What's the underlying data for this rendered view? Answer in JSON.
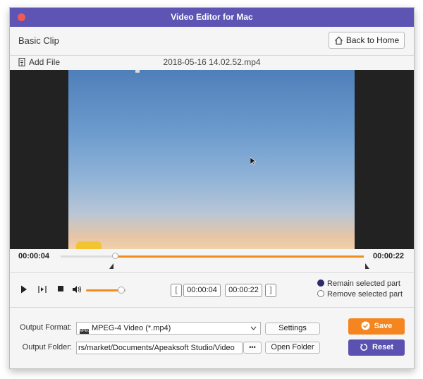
{
  "window": {
    "title": "Video Editor for Mac"
  },
  "header": {
    "clip_title": "Basic Clip",
    "back_home_label": "Back to Home"
  },
  "file_bar": {
    "add_file_label": "Add File",
    "file_name": "2018-05-16 14.02.52.mp4"
  },
  "timeline": {
    "current_time": "00:00:04",
    "end_time": "00:00:22",
    "played_fraction": 0.18
  },
  "playback": {
    "volume_fraction": 0.9,
    "start_time": "00:00:04",
    "end_time": "00:00:22",
    "remain_label": "Remain selected part",
    "remove_label": "Remove selected part",
    "selected_option": "remain"
  },
  "output": {
    "format_label": "Output Format:",
    "format_value": "MPEG-4 Video (*.mp4)",
    "format_badge": "MPEG 4",
    "settings_label": "Settings",
    "folder_label": "Output Folder:",
    "folder_value": "rs/market/Documents/Apeaksoft Studio/Video",
    "browse_label": "•••",
    "open_folder_label": "Open Folder"
  },
  "actions": {
    "save_label": "Save",
    "reset_label": "Reset"
  },
  "colors": {
    "accent_purple": "#5d54b4",
    "accent_orange": "#f28c1c",
    "close_red": "#ee5b55"
  },
  "icons": [
    "home-icon",
    "add-file-icon",
    "play-icon",
    "step-icon",
    "stop-icon",
    "volume-icon",
    "format-icon",
    "check-icon",
    "reset-icon"
  ]
}
